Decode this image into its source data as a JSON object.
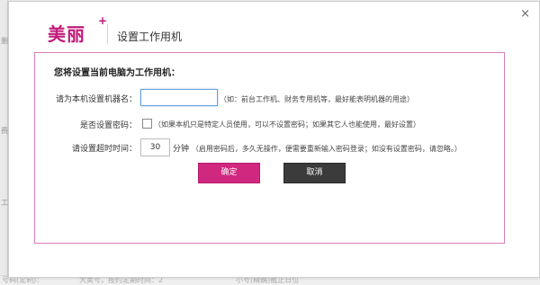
{
  "dialog": {
    "close_glyph": "×",
    "logo_text": "美丽",
    "logo_plus": "+",
    "title": "设置工作用机"
  },
  "form": {
    "heading": "您将设置当前电脑为工作用机：",
    "name_label": "请为本机设置机器名：",
    "name_value": "",
    "name_hint": "（如：前台工作机、财务专用机等，最好能表明机器的用途）",
    "password_label": "是否设置密码：",
    "password_checked": false,
    "password_hint": "（如果本机只是特定人员使用，可以不设置密码；如果其它人也能使用，最好设置）",
    "timeout_label": "请设置超时时间：",
    "timeout_value": "30",
    "timeout_unit": "分钟",
    "timeout_hint": "（启用密码后，多久无操作，便需要重新输入密码登录；如没有设置密码，请忽略。）"
  },
  "buttons": {
    "ok": "确定",
    "cancel": "取消"
  },
  "background": {
    "bottom_left": "号码(定制)：",
    "bottom_mid1": "大类号，按约定期时间：2",
    "bottom_mid2": "小号(精确)截止日位"
  },
  "colors": {
    "accent": "#c2197a",
    "ok_button": "#d1287f",
    "cancel_button": "#3b3b3b",
    "panel_border": "#d97fb8"
  }
}
